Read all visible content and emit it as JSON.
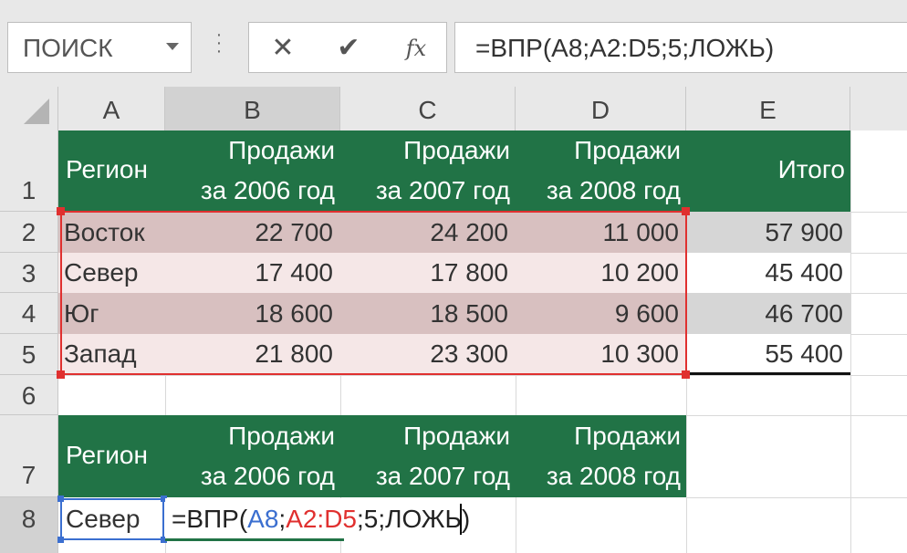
{
  "formula_bar": {
    "name_box": "ПОИСК",
    "formula": "=ВПР(A8;A2:D5;5;ЛОЖЬ)",
    "cancel_symbol": "✕",
    "enter_symbol": "✔",
    "fx_symbol": "fx"
  },
  "columns": [
    "A",
    "B",
    "C",
    "D",
    "E"
  ],
  "rows": [
    "1",
    "2",
    "3",
    "4",
    "5",
    "6",
    "7",
    "8"
  ],
  "header_row": {
    "region": "Регион",
    "sales_label": "Продажи",
    "y2006": "за 2006 год",
    "y2007": "за 2007 год",
    "y2008": "за 2008 год",
    "total": "Итого"
  },
  "table": [
    {
      "region": "Восток",
      "s2006": "22 700",
      "s2007": "24 200",
      "s2008": "11 000",
      "total": "57 900"
    },
    {
      "region": "Север",
      "s2006": "17 400",
      "s2007": "17 800",
      "s2008": "10 200",
      "total": "45 400"
    },
    {
      "region": "Юг",
      "s2006": "18 600",
      "s2007": "18 500",
      "s2008": "9 600",
      "total": "46 700"
    },
    {
      "region": "Запад",
      "s2006": "21 800",
      "s2007": "23 300",
      "s2008": "10 300",
      "total": "55 400"
    }
  ],
  "lookup_row": {
    "region": "Север",
    "formula_prefix": "=ВПР(",
    "ref_a8": "A8",
    "sep1": ";",
    "ref_range": "A2:D5",
    "rest": ";5;ЛОЖЬ)"
  },
  "colors": {
    "header_green": "#217346",
    "range_highlight": "#e0302f",
    "ref_blue": "#3b6fd0"
  }
}
